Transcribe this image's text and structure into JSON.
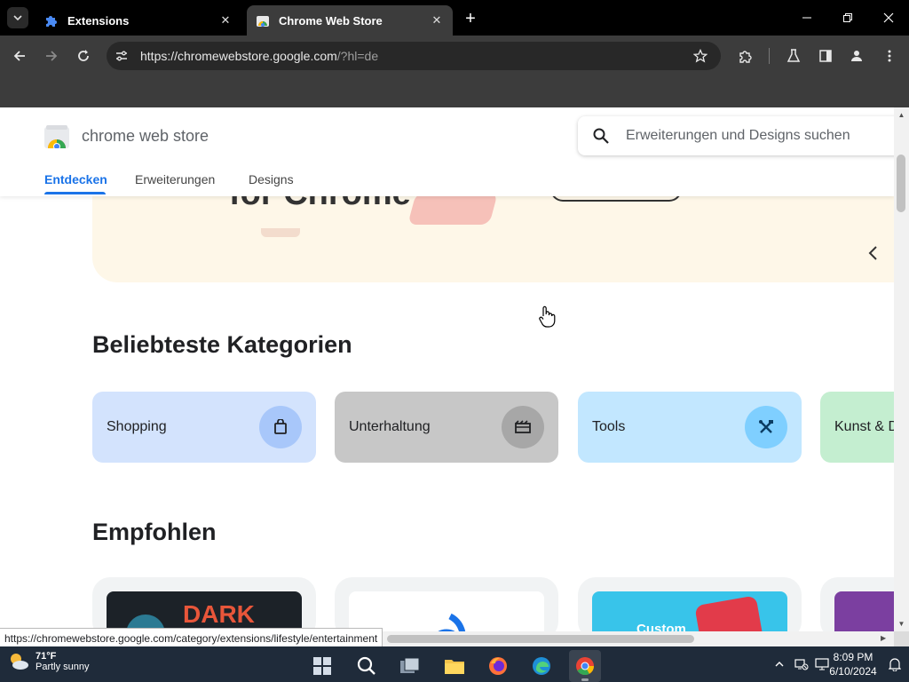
{
  "browser": {
    "tabs": [
      {
        "title": "Extensions",
        "active": false
      },
      {
        "title": "Chrome Web Store",
        "active": true
      }
    ],
    "url_host": "https://chromewebstore.google.com",
    "url_path": "/?hl=de",
    "status_url": "https://chromewebstore.google.com/category/extensions/lifestyle/entertainment"
  },
  "store": {
    "name": "chrome web store",
    "search_placeholder": "Erweiterungen und Designs suchen",
    "nav_tabs": [
      "Entdecken",
      "Erweiterungen",
      "Designs"
    ],
    "hero_text": "for Chrome",
    "categories_title": "Beliebteste Kategorien",
    "categories": [
      {
        "label": "Shopping",
        "icon": "shopping-bag-icon",
        "bg": "#d3e3fd",
        "icon_bg": "#a8c7fa"
      },
      {
        "label": "Unterhaltung",
        "icon": "film-icon",
        "bg": "#c7c7c7",
        "icon_bg": "#a7a7a7"
      },
      {
        "label": "Tools",
        "icon": "tools-icon",
        "bg": "#c2e7ff",
        "icon_bg": "#7fcfff"
      },
      {
        "label": "Kunst & D",
        "icon": "palette-icon",
        "bg": "#c4eed0",
        "icon_bg": "#93d7a8"
      }
    ],
    "featured_title": "Empfohlen",
    "featured": [
      {
        "thumb_text": "DARK"
      },
      {
        "thumb_text": ""
      },
      {
        "thumb_text": "Custom"
      },
      {
        "thumb_text": ""
      }
    ]
  },
  "colors": {
    "accent": "#1a73e8",
    "toolbar": "#3c3c3c",
    "tabstrip": "#000000",
    "taskbar": "#1f2b3a"
  },
  "taskbar": {
    "weather_temp": "71°F",
    "weather_cond": "Partly sunny",
    "time": "8:09 PM",
    "date": "6/10/2024"
  }
}
